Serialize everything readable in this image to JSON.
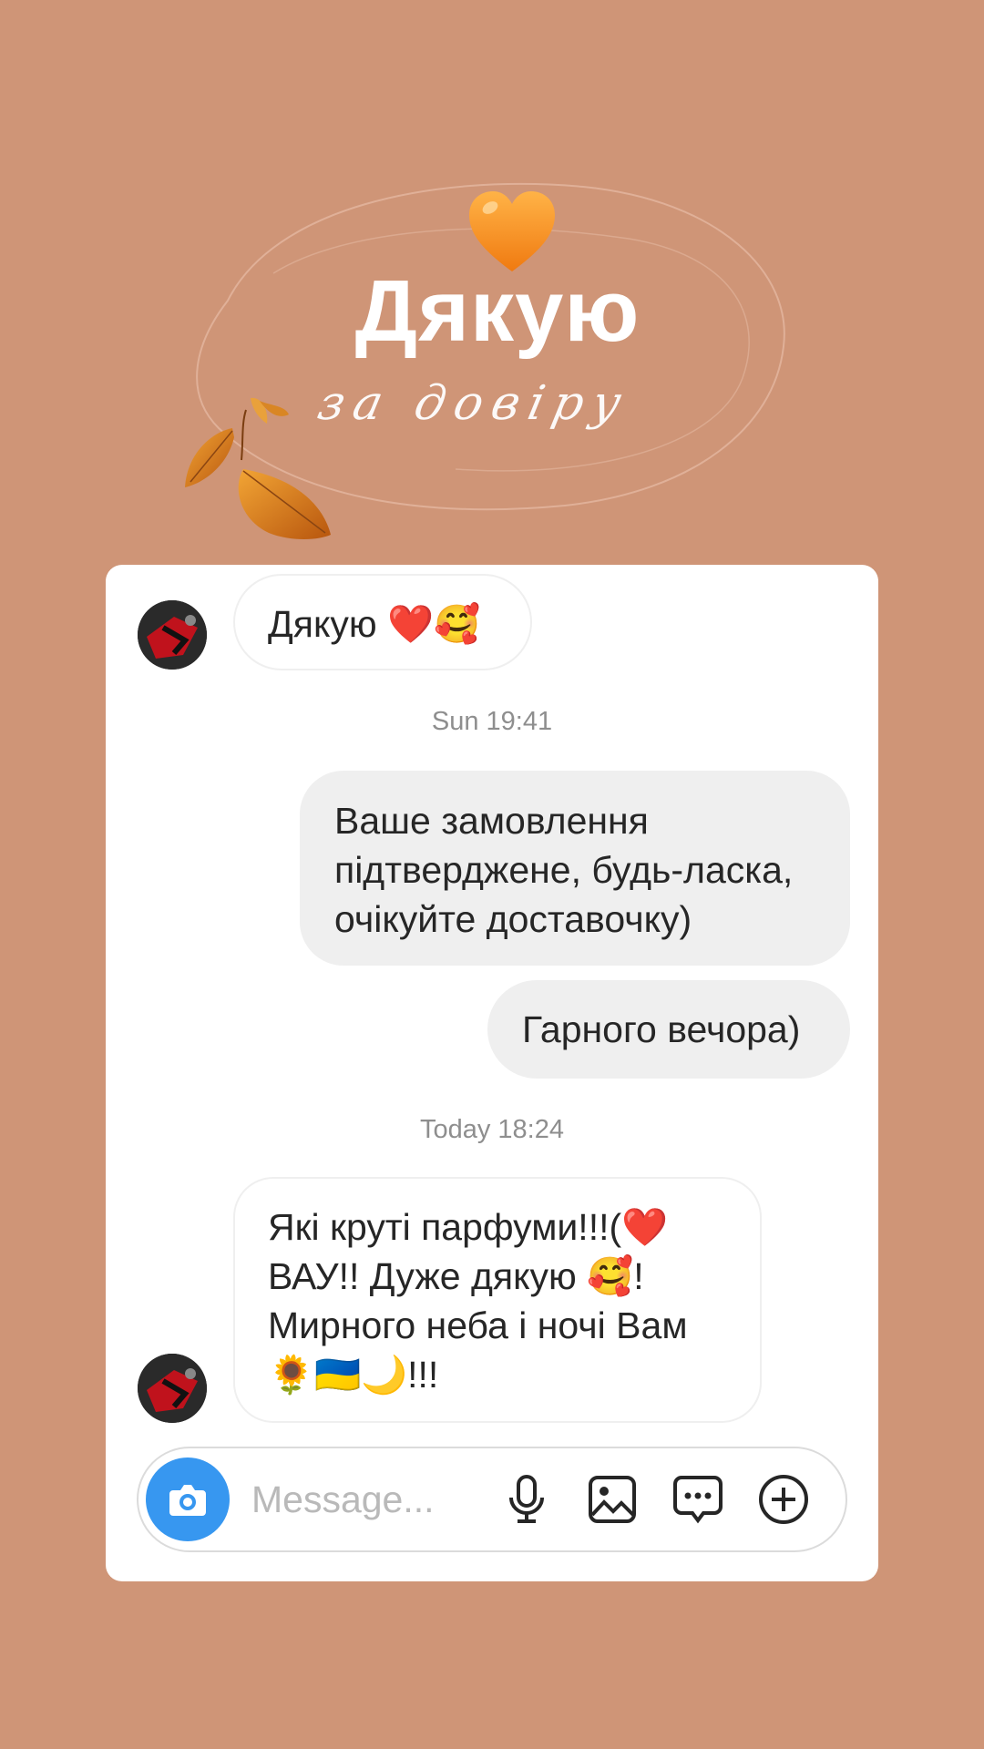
{
  "header": {
    "title": "Дякую",
    "subtitle": "за довіру",
    "heart_icon": "orange-heart-icon",
    "leaves_icon": "autumn-leaves-icon"
  },
  "chat": {
    "avatar_icon": "user-avatar",
    "messages": [
      {
        "direction": "in",
        "text": "Дякую ❤️🥰"
      },
      {
        "type": "timestamp",
        "text": "Sun 19:41"
      },
      {
        "direction": "out",
        "text": "Ваше замовлення\nпідтверджене, будь-ласка,\nочікуйте доставочку)"
      },
      {
        "direction": "out",
        "text": "Гарного вечора)"
      },
      {
        "type": "timestamp",
        "text": "Today 18:24"
      },
      {
        "direction": "in",
        "text": "Які круті парфуми!!!(❤️\nВАУ!! Дуже дякую 🥰!\nМирного неба і ночі Вам\n🌻🇺🇦🌙!!!"
      }
    ],
    "composer": {
      "placeholder": "Message...",
      "camera_icon": "camera-icon",
      "icons": [
        "microphone-icon",
        "gallery-icon",
        "sticker-icon",
        "plus-icon"
      ]
    }
  },
  "colors": {
    "background": "#cf9577",
    "card": "#ffffff",
    "outgoing_bubble": "#efefef",
    "accent": "#3797f0",
    "heart": "#f7901e"
  }
}
